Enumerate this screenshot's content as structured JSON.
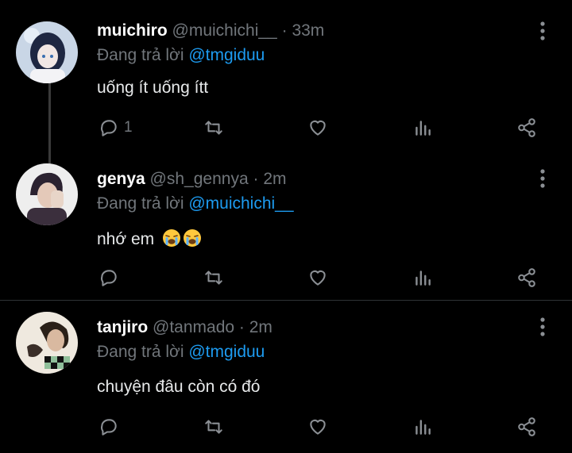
{
  "replies": [
    {
      "name": "muichiro",
      "handle": "@muichichi__",
      "separator": "·",
      "time": "33m",
      "reply_prefix": "Đang trả lời",
      "reply_to": "@tmgiduu",
      "text": "uống ít uống ítt",
      "emoji": [],
      "reply_count": "1",
      "avatar_colors": {
        "bg": "#c9d6e6",
        "hair": "#1e2742",
        "skin": "#f1e7e4"
      }
    },
    {
      "name": "genya",
      "handle": "@sh_gennya",
      "separator": "·",
      "time": "2m",
      "reply_prefix": "Đang trả lời",
      "reply_to": "@muichichi__",
      "text": "nhớ em",
      "emoji": [
        "loudly-crying-face",
        "loudly-crying-face"
      ],
      "reply_count": "",
      "avatar_colors": {
        "bg": "#eeeeee",
        "hair": "#2b2230",
        "skin": "#e4c9b9"
      }
    },
    {
      "name": "tanjiro",
      "handle": "@tanmado",
      "separator": "·",
      "time": "2m",
      "reply_prefix": "Đang trả lời",
      "reply_to": "@tmgiduu",
      "text": "chuyện đâu còn có đó",
      "emoji": [],
      "reply_count": "",
      "avatar_colors": {
        "bg": "#efe9df",
        "hair": "#2a2018",
        "skin": "#d9b9a0"
      }
    }
  ],
  "icons": {
    "reply": "reply-icon",
    "retweet": "retweet-icon",
    "like": "like-icon",
    "analytics": "analytics-icon",
    "share": "share-icon",
    "more": "more-icon"
  },
  "colors": {
    "background": "#000000",
    "name": "#ffffff",
    "muted": "#71767b",
    "mention": "#1d9bf0",
    "divider": "#2f3336"
  }
}
